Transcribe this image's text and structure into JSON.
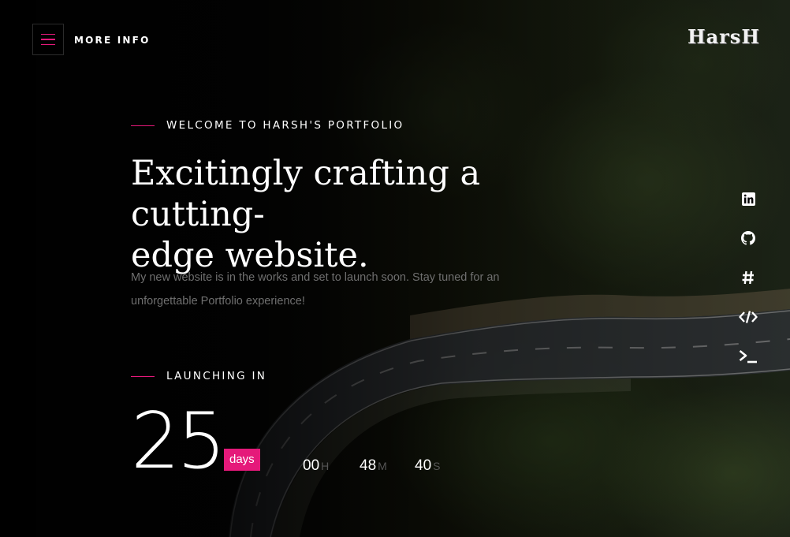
{
  "header": {
    "menu_label": "MORE INFO",
    "logo": "HarsH"
  },
  "hero": {
    "eyebrow": "WELCOME TO HARSH'S PORTFOLIO",
    "headline_line1": "Excitingly crafting a cutting-",
    "headline_line2": "edge website.",
    "subtext_line1": "My new website is in the works and set to launch soon. Stay tuned for an",
    "subtext_line2": "unforgettable Portfolio experience!"
  },
  "countdown": {
    "heading": "LAUNCHING IN",
    "days": "25",
    "days_label": "days",
    "hours": "00",
    "hours_unit": "H",
    "minutes": "48",
    "minutes_unit": "M",
    "seconds": "40",
    "seconds_unit": "S"
  },
  "social": [
    {
      "icon": "linkedin-icon"
    },
    {
      "icon": "github-icon"
    },
    {
      "icon": "hashtag-icon"
    },
    {
      "icon": "code-icon"
    },
    {
      "icon": "terminal-icon"
    }
  ],
  "colors": {
    "accent": "#e5197a",
    "background": "#070707",
    "muted_text": "#6f6f6f"
  }
}
